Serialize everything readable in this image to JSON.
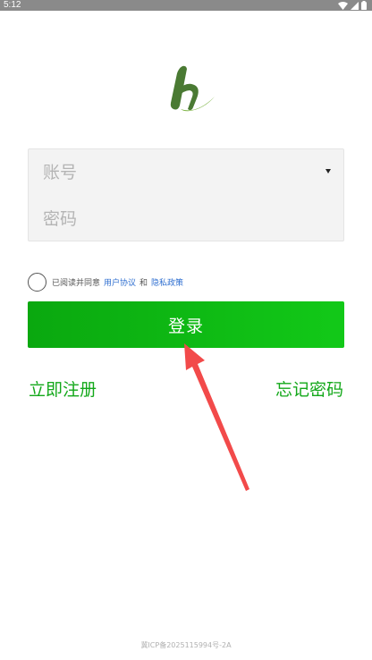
{
  "status_bar": {
    "time": "5:12",
    "icons": [
      "wifi-icon",
      "signal-icon",
      "battery-icon"
    ]
  },
  "logo": {
    "icon": "brand-logo-icon",
    "colors": [
      "#4a7a33",
      "#7cb342"
    ]
  },
  "login_form": {
    "account_placeholder": "账号",
    "account_value": "",
    "password_placeholder": "密码",
    "password_value": ""
  },
  "agreement": {
    "checked": false,
    "text": "已阅读并同意",
    "user_agreement": "用户协议",
    "and": "和",
    "privacy_policy": "隐私政策"
  },
  "login_button": {
    "label": "登录"
  },
  "links": {
    "register": "立即注册",
    "forgot_password": "忘记密码"
  },
  "footer": {
    "icp": "冀ICP备2025115994号-2A"
  },
  "colors": {
    "accent": "#12b518",
    "link_blue": "#2f6fd0",
    "annotation_arrow": "#f24a4a"
  }
}
